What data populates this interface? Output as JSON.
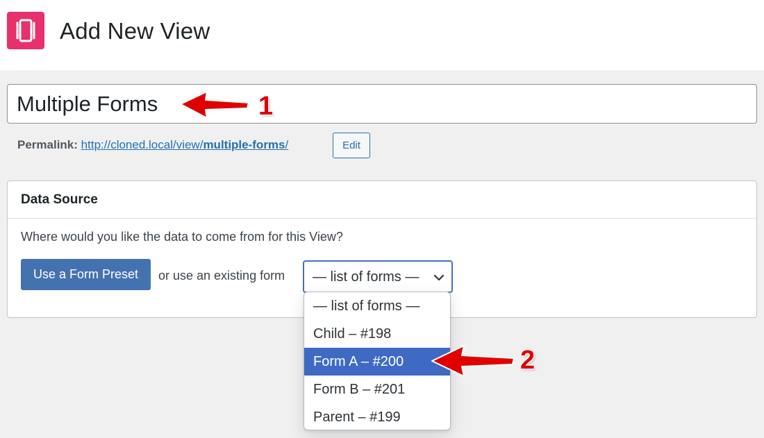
{
  "header": {
    "title": "Add New View",
    "logo_icon": "view-logo-icon",
    "brand_color": "#e8306a"
  },
  "title_field": {
    "value": "Multiple Forms"
  },
  "permalink": {
    "label": "Permalink:",
    "url_base": "http://cloned.local/view/",
    "url_slug": "multiple-forms",
    "url_trailing": "/",
    "edit_label": "Edit"
  },
  "data_source": {
    "heading": "Data Source",
    "question": "Where would you like the data to come from for this View?",
    "preset_button_label": "Use a Form Preset",
    "or_text": "or use an existing form",
    "select_value": "— list of forms —",
    "accent_color": "#4472b0",
    "options": [
      {
        "label": "— list of forms —",
        "selected": false
      },
      {
        "label": "Child – #198",
        "selected": false
      },
      {
        "label": "Form A – #200",
        "selected": true
      },
      {
        "label": "Form B – #201",
        "selected": false
      },
      {
        "label": "Parent – #199",
        "selected": false
      }
    ]
  },
  "annotations": {
    "step1": "1",
    "step2": "2",
    "color": "#e00000"
  }
}
